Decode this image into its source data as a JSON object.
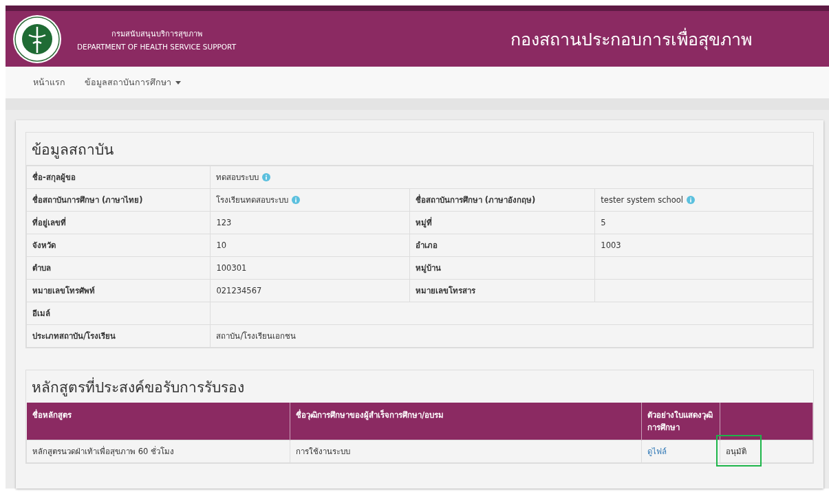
{
  "header": {
    "org_th": "กรมสนับสนุนบริการสุขภาพ",
    "org_en": "DEPARTMENT OF HEALTH SERVICE SUPPORT",
    "title": "กองสถานประกอบการเพื่อสุขภาพ"
  },
  "nav": [
    {
      "label": "หน้าแรก",
      "dropdown": false
    },
    {
      "label": "ข้อมูลสถาบันการศึกษา",
      "dropdown": true
    }
  ],
  "institution": {
    "title": "ข้อมูลสถาบัน",
    "rows": [
      {
        "label": "ชื่อ-สกุลผู้ขอ",
        "value": "ทดสอบระบบ",
        "info": true
      },
      {
        "label": "ชื่อสถาบันการศึกษา (ภาษาไทย)",
        "value": "โรงเรียนทดสอบระบบ",
        "info": true,
        "label2": "ชื่อสถาบันการศึกษา (ภาษาอังกฤษ)",
        "value2": "tester system school",
        "info2": true
      },
      {
        "label": "ที่อยู่เลขที่",
        "value": "123",
        "info": false,
        "label2": "หมู่ที่",
        "value2": "5",
        "info2": false
      },
      {
        "label": "จังหวัด",
        "value": "10",
        "info": false,
        "label2": "อำเภอ",
        "value2": "1003",
        "info2": false
      },
      {
        "label": "ตำบล",
        "value": "100301",
        "info": false,
        "label2": "หมู่บ้าน",
        "info2": false
      },
      {
        "label": "หมายเลขโทรศัพท์",
        "value": "021234567",
        "info": false,
        "label2": "หมายเลขโทรสาร",
        "info2": false
      },
      {
        "label": "อีเมล์",
        "info": false
      },
      {
        "label": "ประเภทสถาบัน/โรงเรียน",
        "value": "สถาบัน/โรงเรียนเอกชน",
        "info": false
      }
    ]
  },
  "courses": {
    "title": "หลักสูตรที่ประสงค์ขอรับการรับรอง",
    "columns": [
      "ชื่อหลักสูตร",
      "ชื่อวุฒิการศึกษาของผู้สำเร็จการศึกษา/อบรม",
      "ตัวอย่างใบแสดงวุฒิการศึกษา"
    ],
    "rows": [
      {
        "cells": [
          {
            "kind": "text",
            "text": "หลักสูตรนวดฝ่าเท้าเพื่อสุขภาพ 60 ชั่วโมง",
            "highlighted": false
          },
          {
            "kind": "text",
            "text": "การใช้งานระบบ",
            "highlighted": false
          },
          {
            "kind": "link",
            "text": "ดูไฟล์",
            "highlighted": false
          },
          {
            "kind": "text",
            "text": "อนุมัติ",
            "highlighted": true
          }
        ]
      }
    ]
  }
}
